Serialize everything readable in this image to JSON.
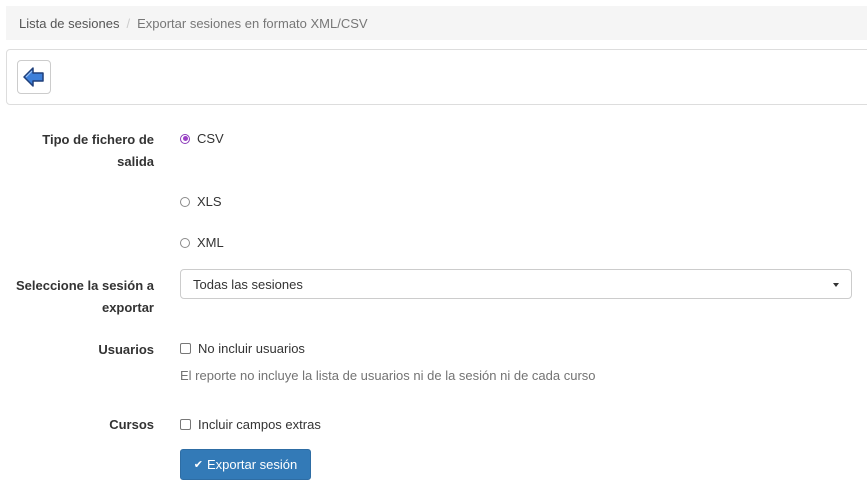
{
  "breadcrumb": {
    "items": [
      "Lista de sesiones",
      "Exportar sesiones en formato XML/CSV"
    ],
    "separator": "/"
  },
  "toolbar": {
    "back_icon": "back-arrow-icon"
  },
  "form": {
    "file_type": {
      "label_line1": "Tipo de fichero de",
      "label_line2": "salida",
      "options": [
        "CSV",
        "XLS",
        "XML"
      ],
      "selected": "CSV"
    },
    "session": {
      "label_line1": "Seleccione la sesión a",
      "label_line2": "exportar",
      "selected_value": "Todas las sesiones"
    },
    "users": {
      "label": "Usuarios",
      "checkbox_label": "No incluir usuarios",
      "checked": false,
      "help": "El reporte no incluye la lista de usuarios ni de la sesión ni de cada curso"
    },
    "courses": {
      "label": "Cursos",
      "checkbox_label": "Incluir campos extras",
      "checked": false
    },
    "submit_label": "Exportar sesión"
  },
  "colors": {
    "primary": "#337ab7",
    "radio_accent": "#9b3fc7"
  }
}
